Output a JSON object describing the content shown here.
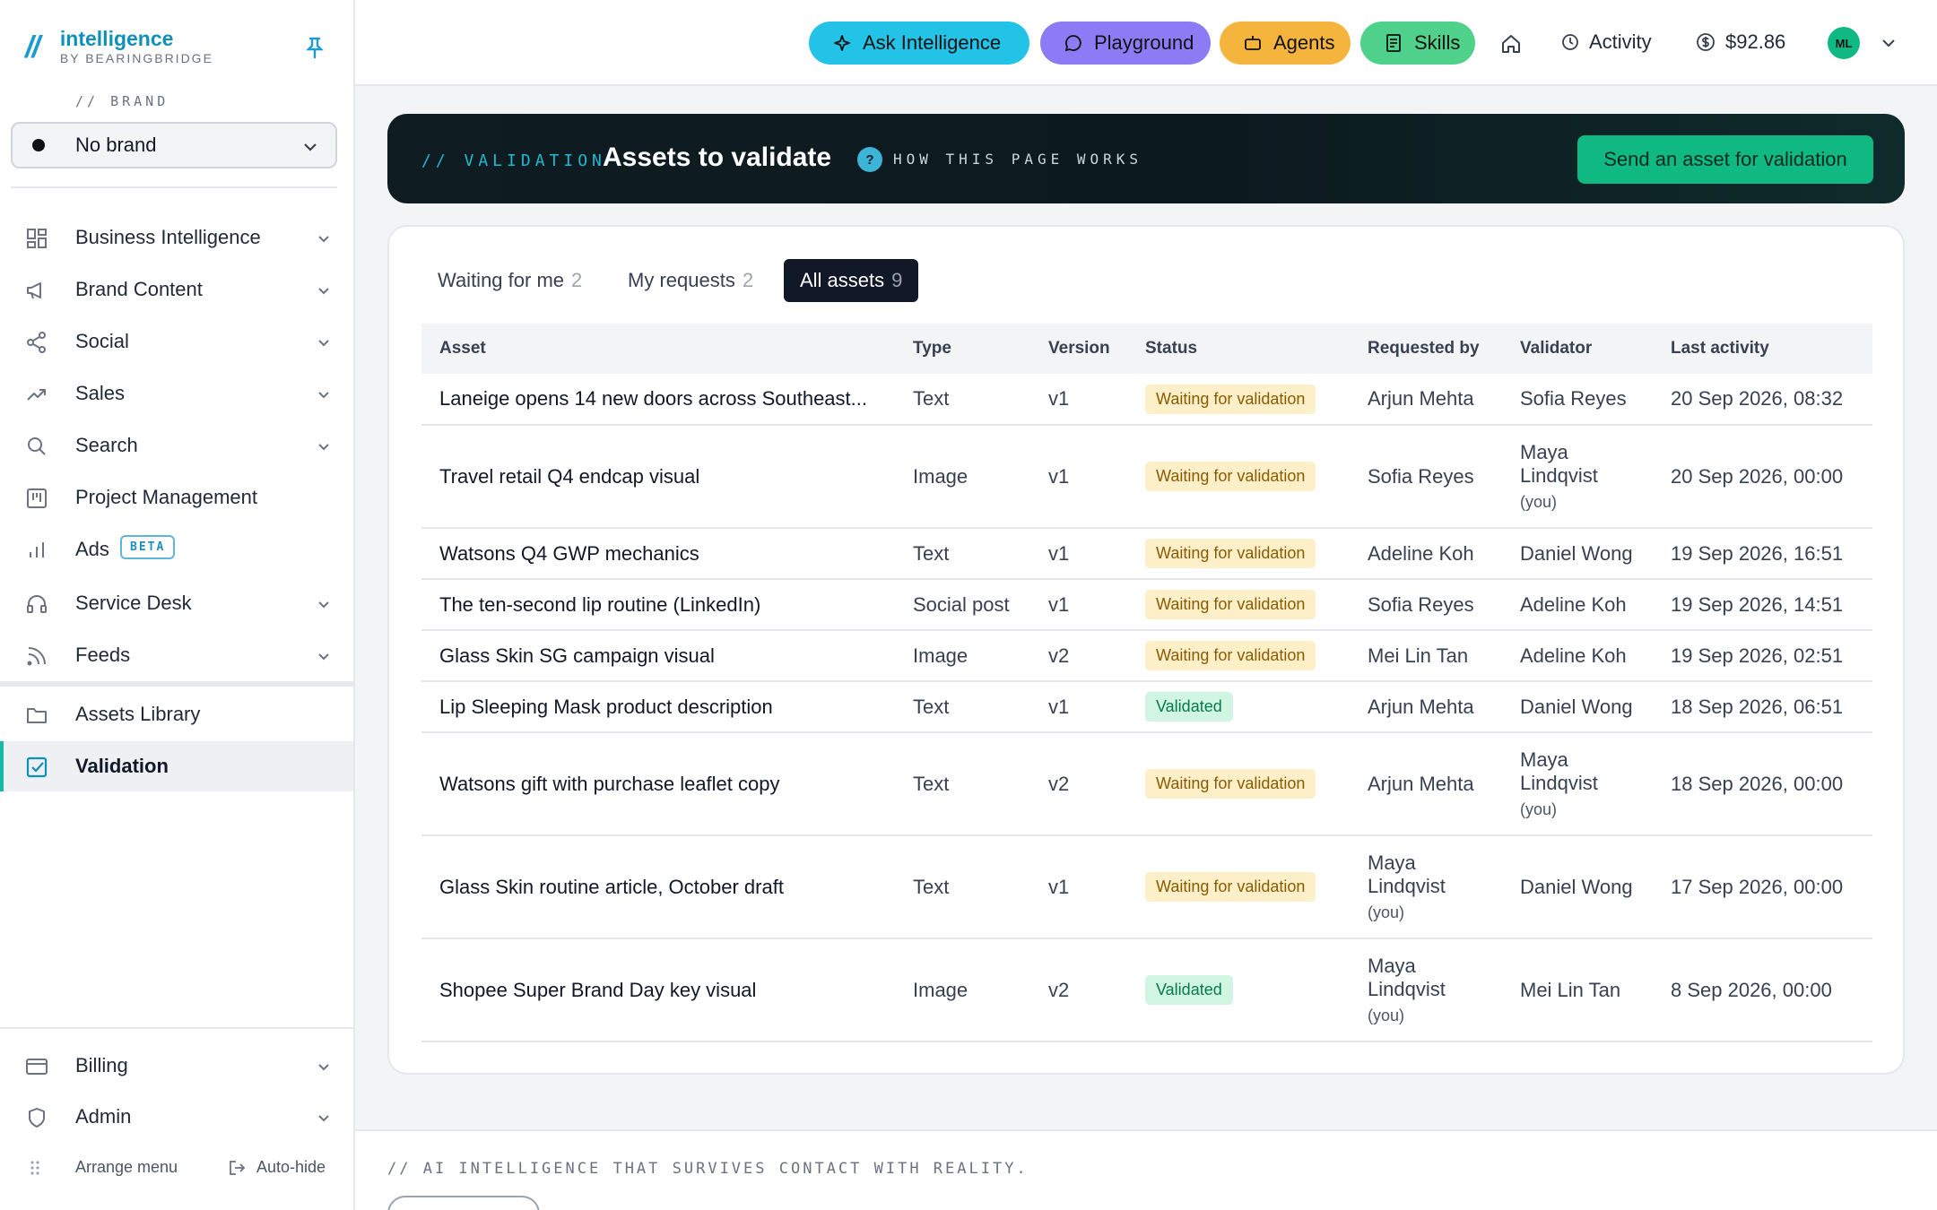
{
  "sidebar": {
    "logo_mark": "//",
    "app_name": "intelligence",
    "app_by": "BY BEARINGBRIDGE",
    "brand_label": "// BRAND",
    "brand_value": "No brand",
    "items": [
      {
        "label": "Business Intelligence",
        "icon": "grid-icon"
      },
      {
        "label": "Brand Content",
        "icon": "megaphone-icon"
      },
      {
        "label": "Social",
        "icon": "share-icon"
      },
      {
        "label": "Sales",
        "icon": "trend-icon"
      },
      {
        "label": "Search",
        "icon": "search-icon"
      },
      {
        "label": "Project Management",
        "icon": "kanban-icon"
      },
      {
        "label": "Ads",
        "icon": "bar-chart-icon",
        "badge": "BETA"
      },
      {
        "label": "Service Desk",
        "icon": "headset-icon"
      },
      {
        "label": "Feeds",
        "icon": "rss-icon"
      },
      {
        "label": "Assets Library",
        "icon": "folder-icon"
      },
      {
        "label": "Validation",
        "icon": "checkbox-icon"
      },
      {
        "label": "Billing",
        "icon": "card-icon"
      },
      {
        "label": "Admin",
        "icon": "shield-icon"
      }
    ],
    "arrange": "Arrange menu",
    "autohide": "Auto-hide"
  },
  "topbar": {
    "ask": "Ask Intelligence",
    "playground": "Playground",
    "agents": "Agents",
    "skills": "Skills",
    "activity": "Activity",
    "balance": "$92.86",
    "avatar": "ML",
    "colors": {
      "ask": "#22c3e6",
      "playground": "#8b7cf6",
      "agents": "#f5b43c",
      "skills": "#4fd18b"
    }
  },
  "hero": {
    "kicker": "// VALIDATION",
    "title": "Assets to validate",
    "help_icon": "?",
    "how": "HOW THIS PAGE WORKS",
    "cta": "Send an asset for validation"
  },
  "tabs": [
    {
      "label": "Waiting for me",
      "count": "2"
    },
    {
      "label": "My requests",
      "count": "2"
    },
    {
      "label": "All assets",
      "count": "9"
    }
  ],
  "table": {
    "headers": [
      "Asset",
      "Type",
      "Version",
      "Status",
      "Requested by",
      "Validator",
      "Last activity"
    ],
    "rows": [
      {
        "asset": "Laneige opens 14 new doors across Southeast...",
        "type": "Text",
        "version": "v1",
        "status": "Waiting for validation",
        "requested": "Arjun Mehta",
        "validator": "Sofia Reyes",
        "last": "20 Sep 2026, 08:32"
      },
      {
        "asset": "Travel retail Q4 endcap visual",
        "type": "Image",
        "version": "v1",
        "status": "Waiting for validation",
        "requested": "Sofia Reyes",
        "validator": "Maya Lindqvist",
        "validator_you": "(you)",
        "last": "20 Sep 2026, 00:00"
      },
      {
        "asset": "Watsons Q4 GWP mechanics",
        "type": "Text",
        "version": "v1",
        "status": "Waiting for validation",
        "requested": "Adeline Koh",
        "validator": "Daniel Wong",
        "last": "19 Sep 2026, 16:51"
      },
      {
        "asset": "The ten-second lip routine (LinkedIn)",
        "type": "Social post",
        "version": "v1",
        "status": "Waiting for validation",
        "requested": "Sofia Reyes",
        "validator": "Adeline Koh",
        "last": "19 Sep 2026, 14:51"
      },
      {
        "asset": "Glass Skin SG campaign visual",
        "type": "Image",
        "version": "v2",
        "status": "Waiting for validation",
        "requested": "Mei Lin Tan",
        "validator": "Adeline Koh",
        "last": "19 Sep 2026, 02:51"
      },
      {
        "asset": "Lip Sleeping Mask product description",
        "type": "Text",
        "version": "v1",
        "status": "Validated",
        "requested": "Arjun Mehta",
        "validator": "Daniel Wong",
        "last": "18 Sep 2026, 06:51"
      },
      {
        "asset": "Watsons gift with purchase leaflet copy",
        "type": "Text",
        "version": "v2",
        "status": "Waiting for validation",
        "requested": "Arjun Mehta",
        "validator": "Maya Lindqvist",
        "validator_you": "(you)",
        "last": "18 Sep 2026, 00:00"
      },
      {
        "asset": "Glass Skin routine article, October draft",
        "type": "Text",
        "version": "v1",
        "status": "Waiting for validation",
        "requested": "Maya Lindqvist",
        "requested_you": "(you)",
        "validator": "Daniel Wong",
        "last": "17 Sep 2026, 00:00"
      },
      {
        "asset": "Shopee Super Brand Day key visual",
        "type": "Image",
        "version": "v2",
        "status": "Validated",
        "requested": "Maya Lindqvist",
        "requested_you": "(you)",
        "validator": "Mei Lin Tan",
        "last": "8 Sep 2026, 00:00"
      }
    ]
  },
  "footer": {
    "tagline": "// AI INTELLIGENCE THAT SURVIVES CONTACT WITH REALITY."
  }
}
